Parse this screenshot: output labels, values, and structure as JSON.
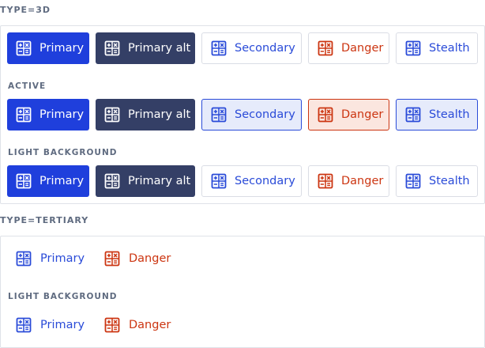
{
  "sections": {
    "type_3d": "TYPE=3D",
    "type_tertiary": "TYPE=TERTIARY"
  },
  "sub_labels": {
    "active": "ACTIVE",
    "light_background": "LIGHT BACKGROUND"
  },
  "buttons": {
    "primary": "Primary",
    "primary_alt": "Primary alt",
    "secondary": "Secondary",
    "danger": "Danger",
    "stealth": "Stealth"
  },
  "icons": {
    "button_icon": "calculator-icon"
  },
  "colors": {
    "primary": "#1f3fdc",
    "primary_alt": "#343f66",
    "secondary_text": "#2a4bd8",
    "danger_text": "#cc3511",
    "border": "#dadde5"
  }
}
